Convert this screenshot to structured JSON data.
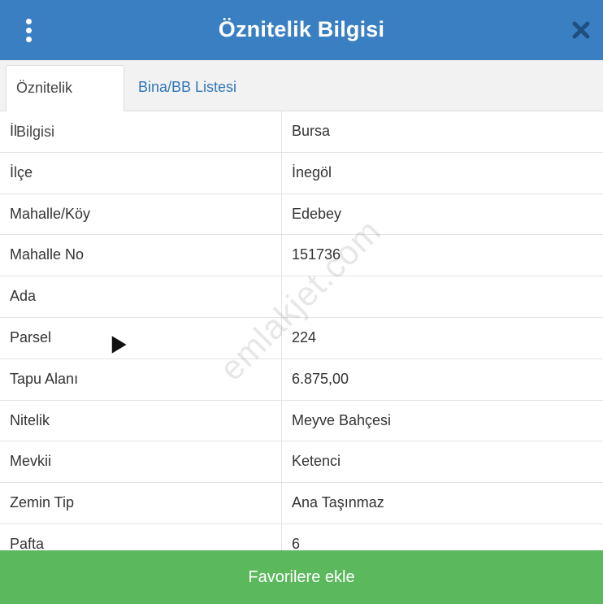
{
  "header": {
    "title": "Öznitelik Bilgisi",
    "menu_icon": "more-vertical-icon",
    "close_icon": "close-icon"
  },
  "tabs": [
    {
      "label": "Öznitelik Bilgisi",
      "active": true
    },
    {
      "label": "Bina/BB Listesi",
      "active": false
    }
  ],
  "attributes": [
    {
      "key": "İl",
      "value": "Bursa"
    },
    {
      "key": "İlçe",
      "value": "İnegöl"
    },
    {
      "key": "Mahalle/Köy",
      "value": "Edebey"
    },
    {
      "key": "Mahalle No",
      "value": "151736"
    },
    {
      "key": "Ada",
      "value": ""
    },
    {
      "key": "Parsel",
      "value": "224"
    },
    {
      "key": "Tapu Alanı",
      "value": "6.875,00"
    },
    {
      "key": "Nitelik",
      "value": "Meyve Bahçesi"
    },
    {
      "key": "Mevkii",
      "value": "Ketenci"
    },
    {
      "key": "Zemin Tip",
      "value": "Ana Taşınmaz"
    },
    {
      "key": "Pafta",
      "value": "6"
    }
  ],
  "watermark": "emlakjet.com",
  "footer": {
    "favorite_button_label": "Favorilere ekle"
  },
  "colors": {
    "header_bg": "#3a7fc2",
    "tab_link": "#2e77b8",
    "favorite_bg": "#5cb85c"
  }
}
